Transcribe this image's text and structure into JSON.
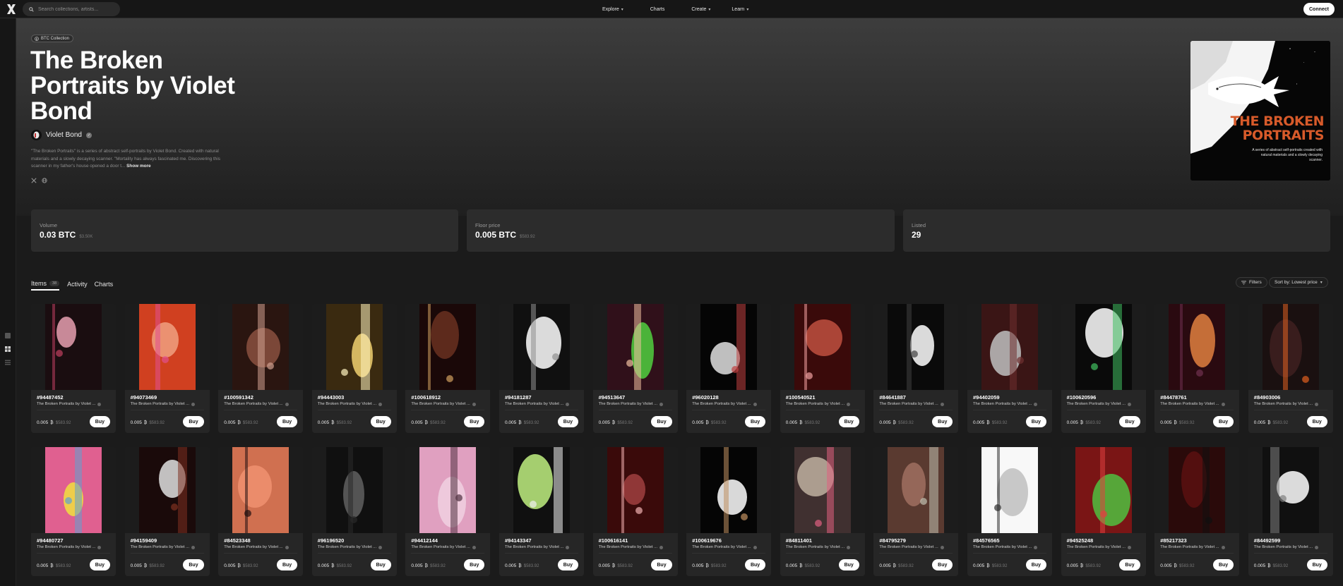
{
  "header": {
    "search_placeholder": "Search collections, artists...",
    "nav": [
      {
        "label": "Explore",
        "dropdown": true
      },
      {
        "label": "Charts",
        "dropdown": false
      },
      {
        "label": "Create",
        "dropdown": true
      },
      {
        "label": "Learn",
        "dropdown": true
      }
    ],
    "connect_label": "Connect"
  },
  "collection": {
    "badge": "BTC Collection",
    "title": "The Broken Portraits by Violet Bond",
    "artist": "Violet Bond",
    "description": "\"The Broken Portraits\" is a series of abstract self-portraits by Violet Bond. Created with natural materials and a slowly decaying scanner. \"Mortality has always fascinated me. Discovering this scanner in my father's house opened a door t...",
    "show_more": "Show more",
    "cover_title": "THE BROKEN PORTRAITS",
    "cover_subtitle": "A series of abstract self-portraits created with natural materials and a slowly decaying scanner."
  },
  "stats": [
    {
      "label": "Volume",
      "value": "0.03 BTC",
      "sub": "$3.50K"
    },
    {
      "label": "Floor price",
      "value": "0.005 BTC",
      "sub": "$583.92"
    },
    {
      "label": "Listed",
      "value": "29",
      "sub": ""
    }
  ],
  "tabs": [
    {
      "label": "Items",
      "count": "38",
      "active": true
    },
    {
      "label": "Activity",
      "count": "",
      "active": false
    },
    {
      "label": "Charts",
      "count": "",
      "active": false
    }
  ],
  "toolbar": {
    "filters_label": "Filters",
    "sort_label": "Sort by: Lowest price"
  },
  "card_common": {
    "collection": "The Broken Portraits by Violet ...",
    "price": "0.005",
    "usd": "$583.92",
    "buy_label": "Buy"
  },
  "items": [
    {
      "id": "#94487452",
      "colors": [
        "#1a0d10",
        "#e8a0b0",
        "#c04060"
      ]
    },
    {
      "id": "#94073469",
      "colors": [
        "#d04020",
        "#f0a080",
        "#e05090"
      ]
    },
    {
      "id": "#100591342",
      "colors": [
        "#2a1510",
        "#8a5040",
        "#d0a090"
      ]
    },
    {
      "id": "#94443003",
      "colors": [
        "#3a2a10",
        "#f0d070",
        "#fff4c0"
      ]
    },
    {
      "id": "#100618912",
      "colors": [
        "#1a0808",
        "#6a3020",
        "#d0a060"
      ]
    },
    {
      "id": "#94181287",
      "colors": [
        "#101010",
        "#ffffff",
        "#909090"
      ]
    },
    {
      "id": "#94513647",
      "colors": [
        "#30101a",
        "#50d040",
        "#f0c0a0"
      ]
    },
    {
      "id": "#96020128",
      "colors": [
        "#050505",
        "#e0e0e0",
        "#c04040"
      ]
    },
    {
      "id": "#100540521",
      "colors": [
        "#3a0a0a",
        "#c05040",
        "#f0a0a0"
      ]
    },
    {
      "id": "#84641887",
      "colors": [
        "#0a0a0a",
        "#ffffff",
        "#404040"
      ]
    },
    {
      "id": "#94402059",
      "colors": [
        "#3a1515",
        "#c0c0c0",
        "#703030"
      ]
    },
    {
      "id": "#100620596",
      "colors": [
        "#0a0a0a",
        "#ffffff",
        "#40c060"
      ]
    },
    {
      "id": "#84478761",
      "colors": [
        "#2a0a10",
        "#e08040",
        "#703050"
      ]
    },
    {
      "id": "#84903006",
      "colors": [
        "#1a1010",
        "#402020",
        "#e06020"
      ]
    },
    {
      "id": "#94480727",
      "colors": [
        "#e06090",
        "#f0e040",
        "#60a0d0"
      ]
    },
    {
      "id": "#94159409",
      "colors": [
        "#1a0a0a",
        "#e0e0e0",
        "#803020"
      ]
    },
    {
      "id": "#84523348",
      "colors": [
        "#d07050",
        "#f09070",
        "#201010"
      ]
    },
    {
      "id": "#96196520",
      "colors": [
        "#101010",
        "#606060",
        "#2a2a2a"
      ]
    },
    {
      "id": "#94412144",
      "colors": [
        "#e0a0c0",
        "#f0d0e0",
        "#503040"
      ]
    },
    {
      "id": "#94143347",
      "colors": [
        "#101010",
        "#c0f080",
        "#f0f0f0"
      ]
    },
    {
      "id": "#100616141",
      "colors": [
        "#3a0a0a",
        "#a04040",
        "#f0b0b0"
      ]
    },
    {
      "id": "#100619676",
      "colors": [
        "#050505",
        "#ffffff",
        "#c09060"
      ]
    },
    {
      "id": "#84811401",
      "colors": [
        "#403030",
        "#c0b0a0",
        "#e06080"
      ]
    },
    {
      "id": "#84795279",
      "colors": [
        "#5a3a30",
        "#a07060",
        "#c0c0b0"
      ]
    },
    {
      "id": "#84576565",
      "colors": [
        "#f8f8f8",
        "#c0c0c0",
        "#303030"
      ]
    },
    {
      "id": "#94525248",
      "colors": [
        "#7a1515",
        "#50c040",
        "#e04040"
      ]
    },
    {
      "id": "#85217323",
      "colors": [
        "#2a0a0a",
        "#5a1010",
        "#101010"
      ]
    },
    {
      "id": "#84492599",
      "colors": [
        "#101010",
        "#ffffff",
        "#808080"
      ]
    }
  ]
}
